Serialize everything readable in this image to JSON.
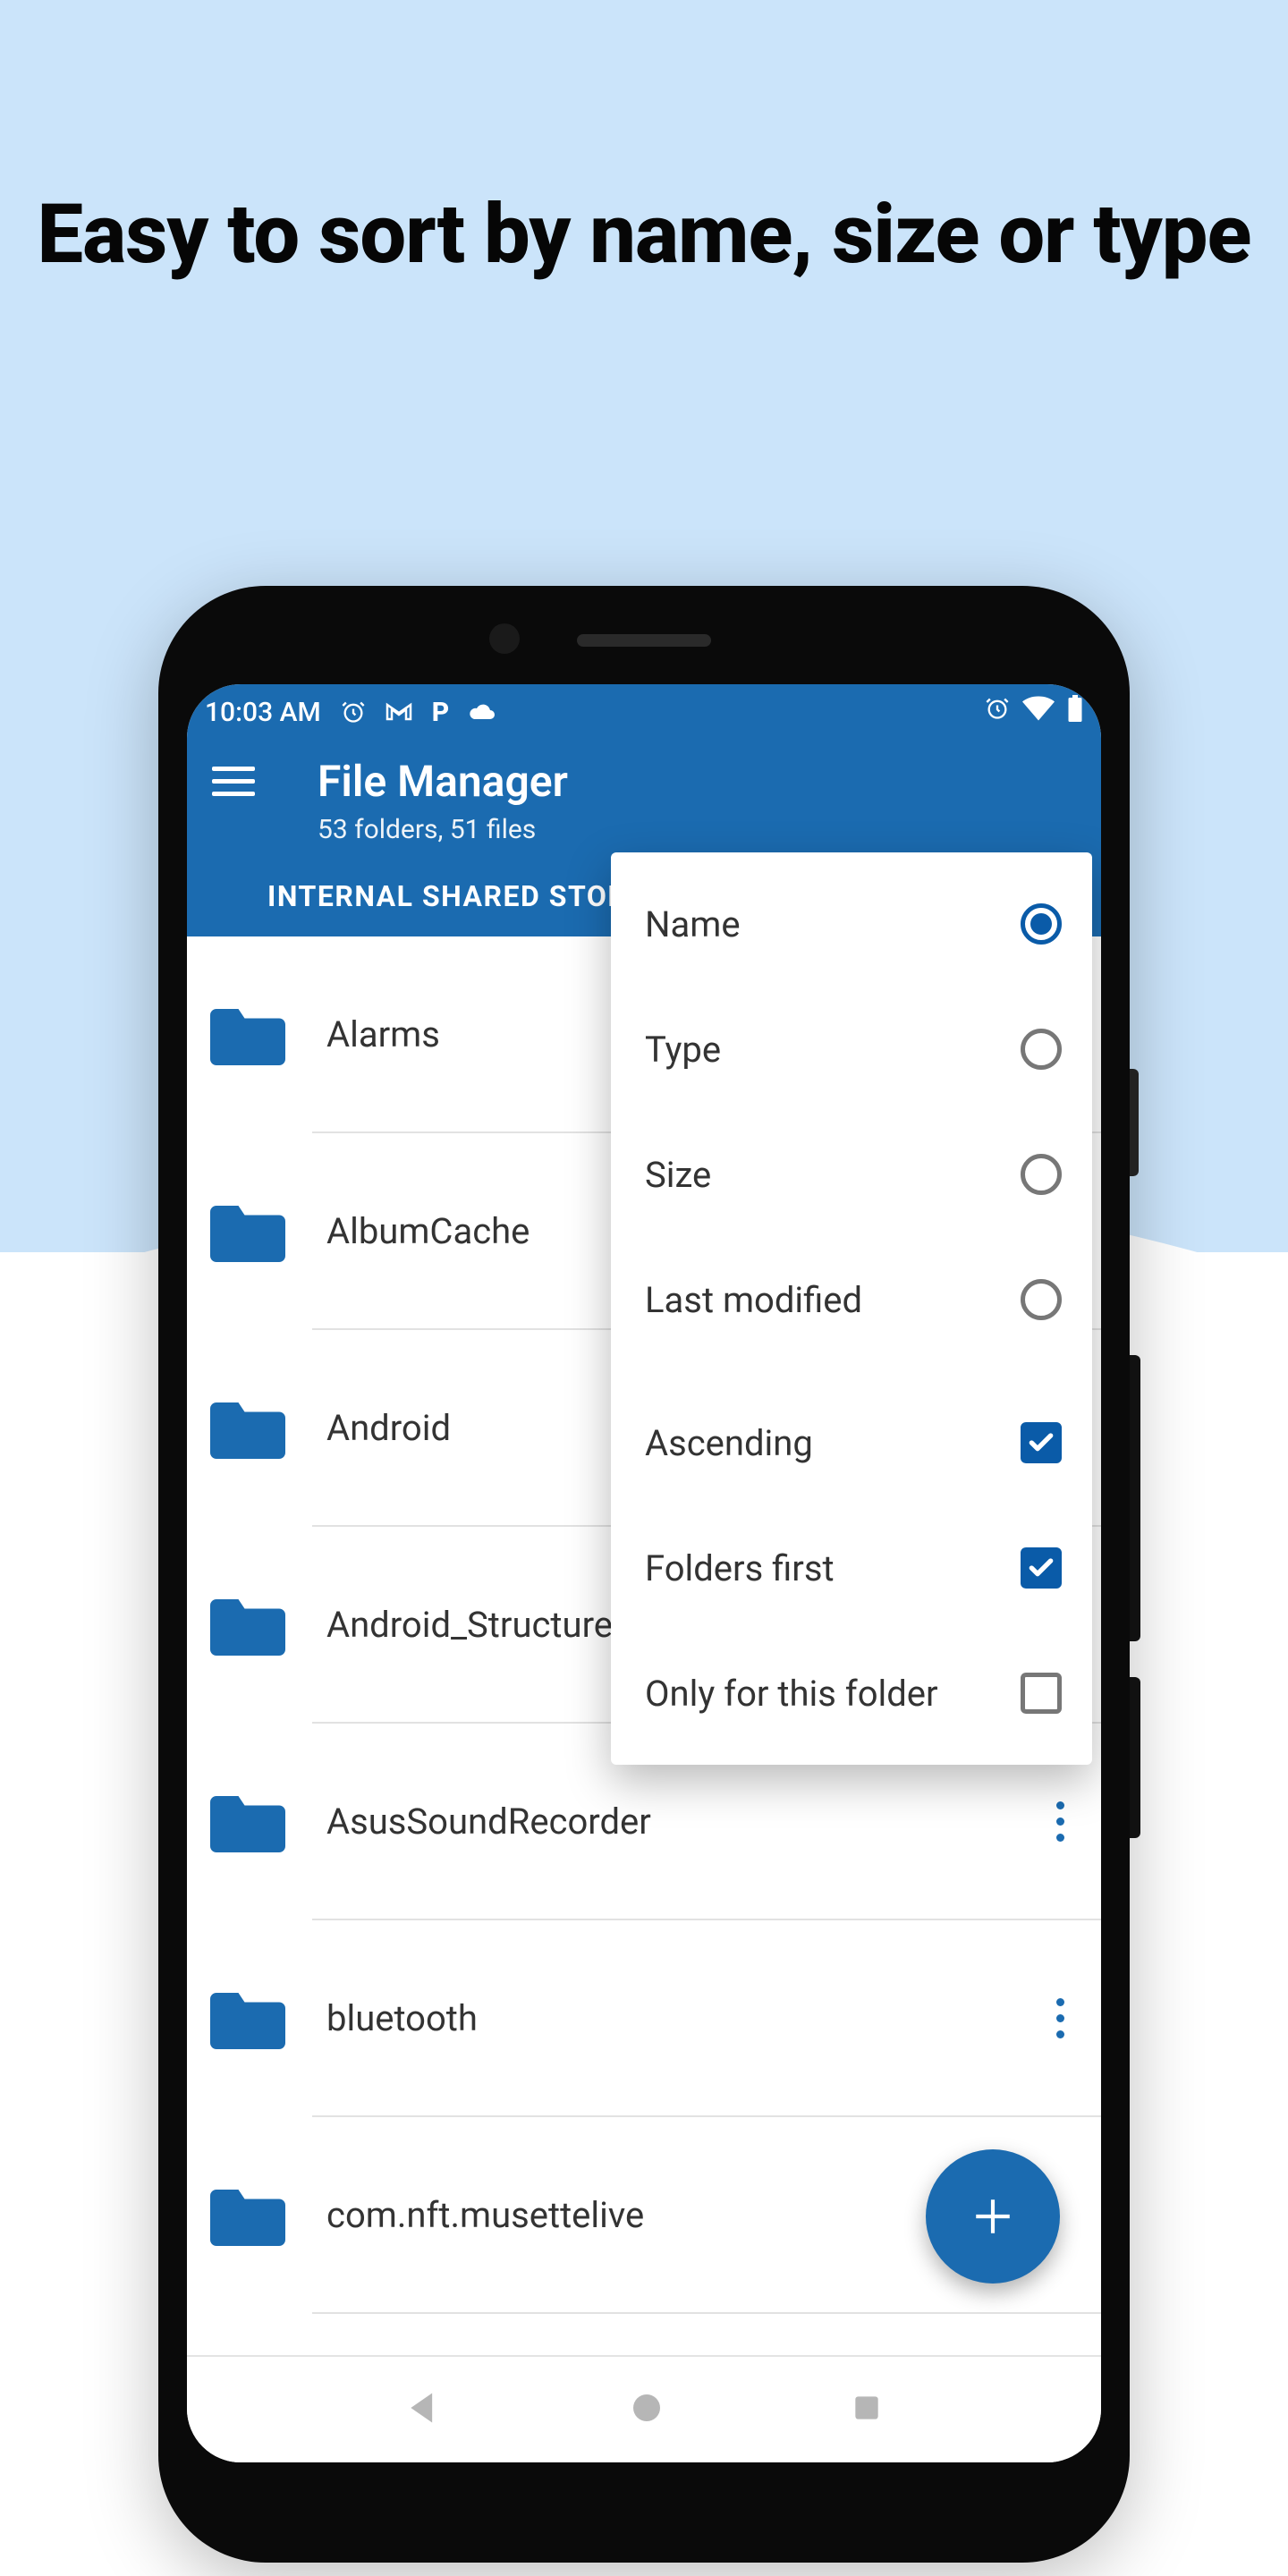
{
  "promo_headline": "Easy to sort by name, size or type",
  "status": {
    "time": "10:03 AM"
  },
  "appbar": {
    "title": "File Manager",
    "subtitle": "53 folders, 51 files",
    "breadcrumb": "INTERNAL SHARED STORAGE"
  },
  "sort_menu": {
    "options": [
      {
        "label": "Name",
        "selected": true
      },
      {
        "label": "Type",
        "selected": false
      },
      {
        "label": "Size",
        "selected": false
      },
      {
        "label": "Last modified",
        "selected": false
      }
    ],
    "toggles": [
      {
        "label": "Ascending",
        "checked": true
      },
      {
        "label": "Folders first",
        "checked": true
      },
      {
        "label": "Only for this folder",
        "checked": false
      }
    ]
  },
  "folders": [
    {
      "name": "Alarms"
    },
    {
      "name": "AlbumCache"
    },
    {
      "name": "Android"
    },
    {
      "name": "Android_Structure"
    },
    {
      "name": "AsusSoundRecorder"
    },
    {
      "name": "bluetooth"
    },
    {
      "name": "com.nft.musettelive"
    }
  ]
}
